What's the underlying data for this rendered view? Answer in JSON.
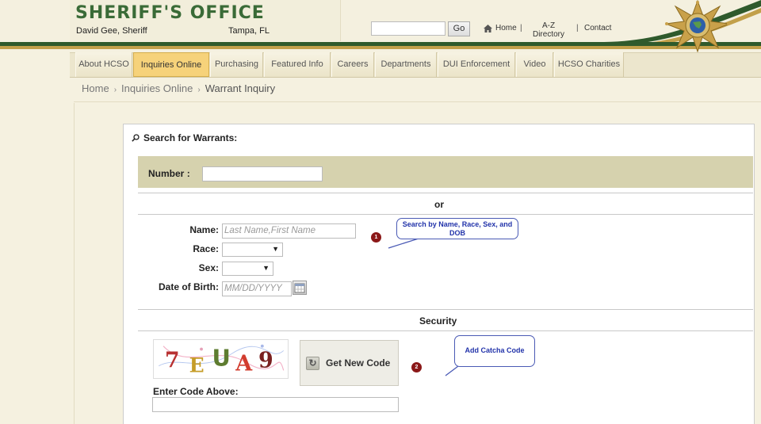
{
  "header": {
    "title": "SHERIFF'S OFFICE",
    "sheriff": "David Gee, Sheriff",
    "city": "Tampa, FL",
    "search": {
      "value": "",
      "go_label": "Go"
    },
    "links": {
      "home": "Home",
      "az_line1": "A-Z",
      "az_line2": "Directory",
      "contact": "Contact"
    },
    "separator": "|"
  },
  "nav": {
    "tabs": [
      {
        "label": "About HCSO",
        "active": false
      },
      {
        "label": "Inquiries Online",
        "active": true
      },
      {
        "label": "Purchasing",
        "active": false
      },
      {
        "label": "Featured Info",
        "active": false
      },
      {
        "label": "Careers",
        "active": false
      },
      {
        "label": "Departments",
        "active": false
      },
      {
        "label": "DUI Enforcement",
        "active": false
      },
      {
        "label": "Video",
        "active": false
      },
      {
        "label": "HCSO Charities",
        "active": false
      }
    ]
  },
  "breadcrumb": {
    "items": [
      "Home",
      "Inquiries Online",
      "Warrant Inquiry"
    ],
    "separator": "›"
  },
  "form": {
    "title": "Search for Warrants:",
    "number_label": "Number",
    "number_colon": ":",
    "or_label": "or",
    "name_label": "Name:",
    "name_placeholder": "Last Name,First Name",
    "race_label": "Race:",
    "sex_label": "Sex:",
    "dob_label": "Date of Birth:",
    "dob_placeholder": "MM/DD/YYYY",
    "security_label": "Security",
    "captcha_text": "7EUA9",
    "new_code_label": "Get New Code",
    "enter_code_label": "Enter Code Above:"
  },
  "annotations": [
    {
      "marker": "1",
      "text": "Search by Name, Race, Sex, and DOB"
    },
    {
      "marker": "2",
      "text": "Add Catcha Code"
    }
  ],
  "colors": {
    "brand_green": "#3a6b37",
    "active_tab": "#f6d27a",
    "annotation_blue": "#2233aa",
    "marker_red": "#8b1818"
  },
  "icons": {
    "home": "home-icon",
    "search": "search-icon",
    "calendar": "calendar-icon",
    "refresh": "refresh-icon",
    "badge": "sheriff-star-badge"
  }
}
